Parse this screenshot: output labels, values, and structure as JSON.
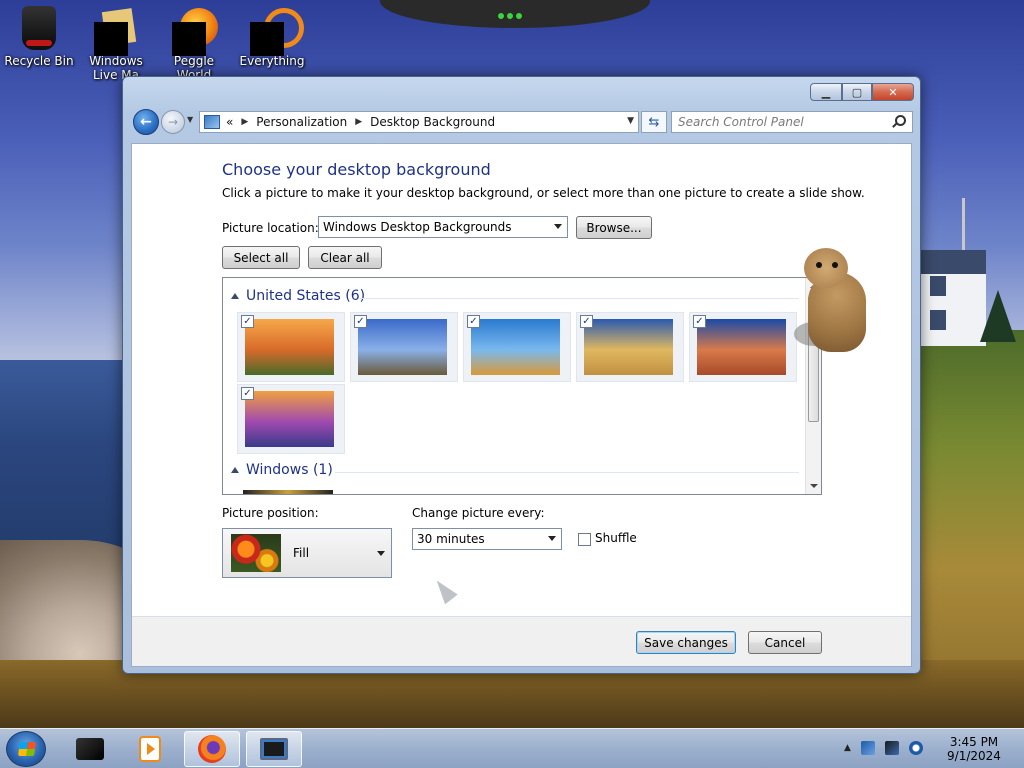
{
  "desktop": {
    "icons": [
      {
        "label": "Recycle Bin",
        "icon": "recycle-bin-icon"
      },
      {
        "label": "Windows Live Ma",
        "icon": "windows-live-mail-icon"
      },
      {
        "label": "Peggle World",
        "icon": "peggle-icon"
      },
      {
        "label": "Everything",
        "icon": "everything-icon"
      }
    ]
  },
  "window": {
    "nav": {
      "breadcrumb_prefix": "«",
      "breadcrumb": [
        "Personalization",
        "Desktop Background"
      ],
      "search_placeholder": "Search Control Panel"
    },
    "heading": "Choose your desktop background",
    "subtext": "Click a picture to make it your desktop background, or select more than one picture to create a slide show.",
    "picture_location_label": "Picture location:",
    "picture_location_value": "Windows Desktop Backgrounds",
    "browse_label": "Browse...",
    "select_all_label": "Select all",
    "clear_all_label": "Clear all",
    "groups": [
      {
        "title": "United States (6)",
        "thumbs": [
          {
            "name": "sunset-field",
            "checked": true,
            "colors": [
              "#f6a84a",
              "#d86a2a",
              "#4a6a2a"
            ]
          },
          {
            "name": "lighthouse",
            "checked": true,
            "colors": [
              "#3a6ac8",
              "#8ab0e8",
              "#6a5a3a"
            ]
          },
          {
            "name": "rock-reflection",
            "checked": true,
            "colors": [
              "#2a7ad0",
              "#7ab8ee",
              "#d89a3a"
            ]
          },
          {
            "name": "hay-bale",
            "checked": true,
            "colors": [
              "#2a5ab0",
              "#e0b860",
              "#c09040"
            ]
          },
          {
            "name": "delicate-arch",
            "checked": true,
            "colors": [
              "#1a4aa8",
              "#d87a4a",
              "#a84a2a"
            ]
          },
          {
            "name": "lake-flowers",
            "checked": true,
            "colors": [
              "#f0a040",
              "#a04ab0",
              "#3a3a8a"
            ]
          }
        ]
      },
      {
        "title": "Windows (1)",
        "thumbs": []
      }
    ],
    "picture_position_label": "Picture position:",
    "picture_position_value": "Fill",
    "change_picture_label": "Change picture every:",
    "change_picture_value": "30 minutes",
    "shuffle_label": "Shuffle",
    "shuffle_checked": false,
    "save_label": "Save changes",
    "cancel_label": "Cancel"
  },
  "taskbar": {
    "items": [
      "media-center",
      "media-player",
      "firefox",
      "control-panel-window"
    ],
    "active_item": "control-panel-window",
    "clock_time": "3:45 PM",
    "clock_date": "9/1/2024"
  },
  "colors": {
    "heading": "#1e3287",
    "window_frame": "#b4c9e4"
  }
}
